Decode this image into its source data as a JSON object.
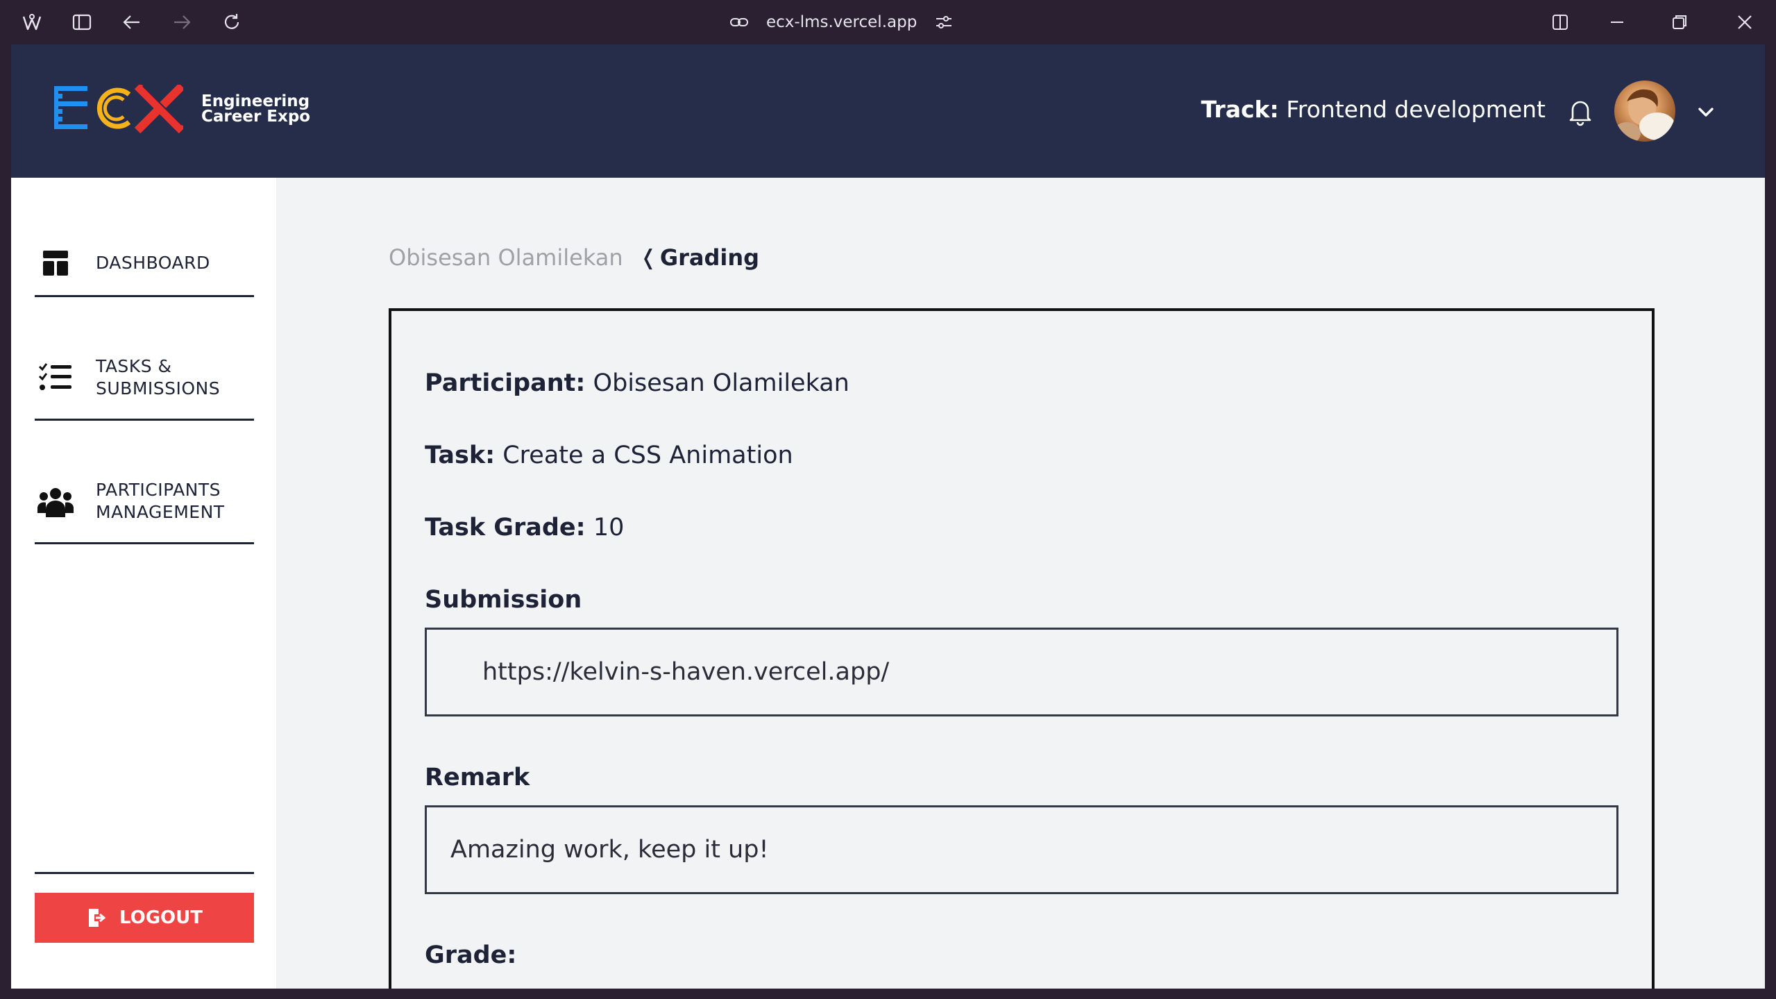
{
  "browser": {
    "url": "ecx-lms.vercel.app",
    "icons": [
      "browser-logo-icon",
      "sidebar-toggle-icon",
      "back-icon",
      "forward-icon",
      "reload-icon",
      "link-icon",
      "site-settings-icon",
      "split-view-icon",
      "minimize-icon",
      "restore-icon",
      "close-icon"
    ]
  },
  "header": {
    "logo_text": "ECX",
    "logo_sub_line1": "Engineering",
    "logo_sub_line2": "Career Expo",
    "track_label": "Track:",
    "track_value": "Frontend development",
    "colors": {
      "header_bg": "#252d4a",
      "logo_blue": "#1f8ff0",
      "logo_yellow": "#f6b21a",
      "logo_red": "#e8322e"
    }
  },
  "sidebar": {
    "items": [
      {
        "line1": "DASHBOARD",
        "line2": "",
        "icon": "dashboard-icon"
      },
      {
        "line1": "TASKS &",
        "line2": "SUBMISSIONS",
        "icon": "task-list-icon"
      },
      {
        "line1": "PARTICIPANTS",
        "line2": "MANAGEMENT",
        "icon": "users-icon"
      }
    ],
    "logout_label": "LOGOUT",
    "logout_color": "#ef4444"
  },
  "breadcrumb": {
    "previous": "Obisesan Olamilekan",
    "separator": "❬",
    "current": "Grading"
  },
  "grading": {
    "participant_label": "Participant:",
    "participant_value": "Obisesan Olamilekan",
    "task_label": "Task:",
    "task_value": "Create a CSS Animation",
    "task_grade_label": "Task Grade:",
    "task_grade_value": "10",
    "submission_label": "Submission",
    "submission_value": "https://kelvin-s-haven.vercel.app/",
    "remark_label": "Remark",
    "remark_value": "Amazing work, keep it up!",
    "grade_label": "Grade:"
  }
}
